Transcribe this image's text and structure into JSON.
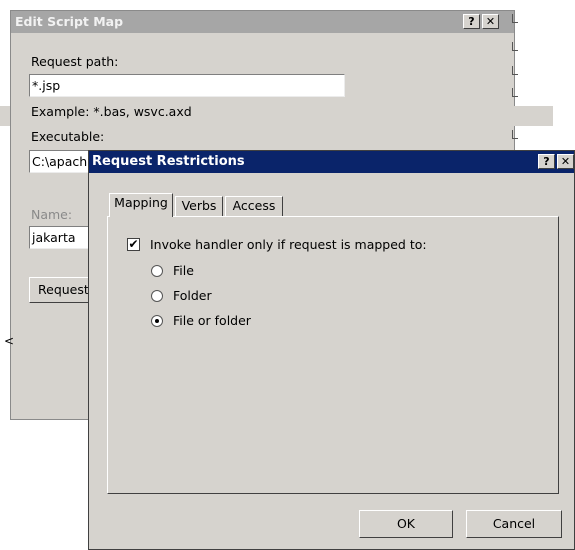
{
  "edit_script_map": {
    "title": "Edit Script Map",
    "help_glyph": "?",
    "close_glyph": "✕",
    "request_path_label": "Request path:",
    "request_path_value": "*.jsp",
    "example_text": "Example: *.bas, wsvc.axd",
    "executable_label": "Executable:",
    "executable_value": "C:\\apach",
    "name_label": "Name:",
    "name_value": "jakarta",
    "request_button_label": "Request",
    "left_edge_glyph": "<"
  },
  "request_restrictions": {
    "title": "Request Restrictions",
    "help_glyph": "?",
    "close_glyph": "✕",
    "tabs": [
      {
        "label": "Mapping",
        "active": true
      },
      {
        "label": "Verbs",
        "active": false
      },
      {
        "label": "Access",
        "active": false
      }
    ],
    "invoke_checkbox_label": "Invoke handler only if request is mapped to:",
    "invoke_checked": true,
    "check_glyph": "✔",
    "options": [
      {
        "label": "File",
        "selected": false
      },
      {
        "label": "Folder",
        "selected": false
      },
      {
        "label": "File or folder",
        "selected": true
      }
    ],
    "ok_label": "OK",
    "cancel_label": "Cancel"
  }
}
